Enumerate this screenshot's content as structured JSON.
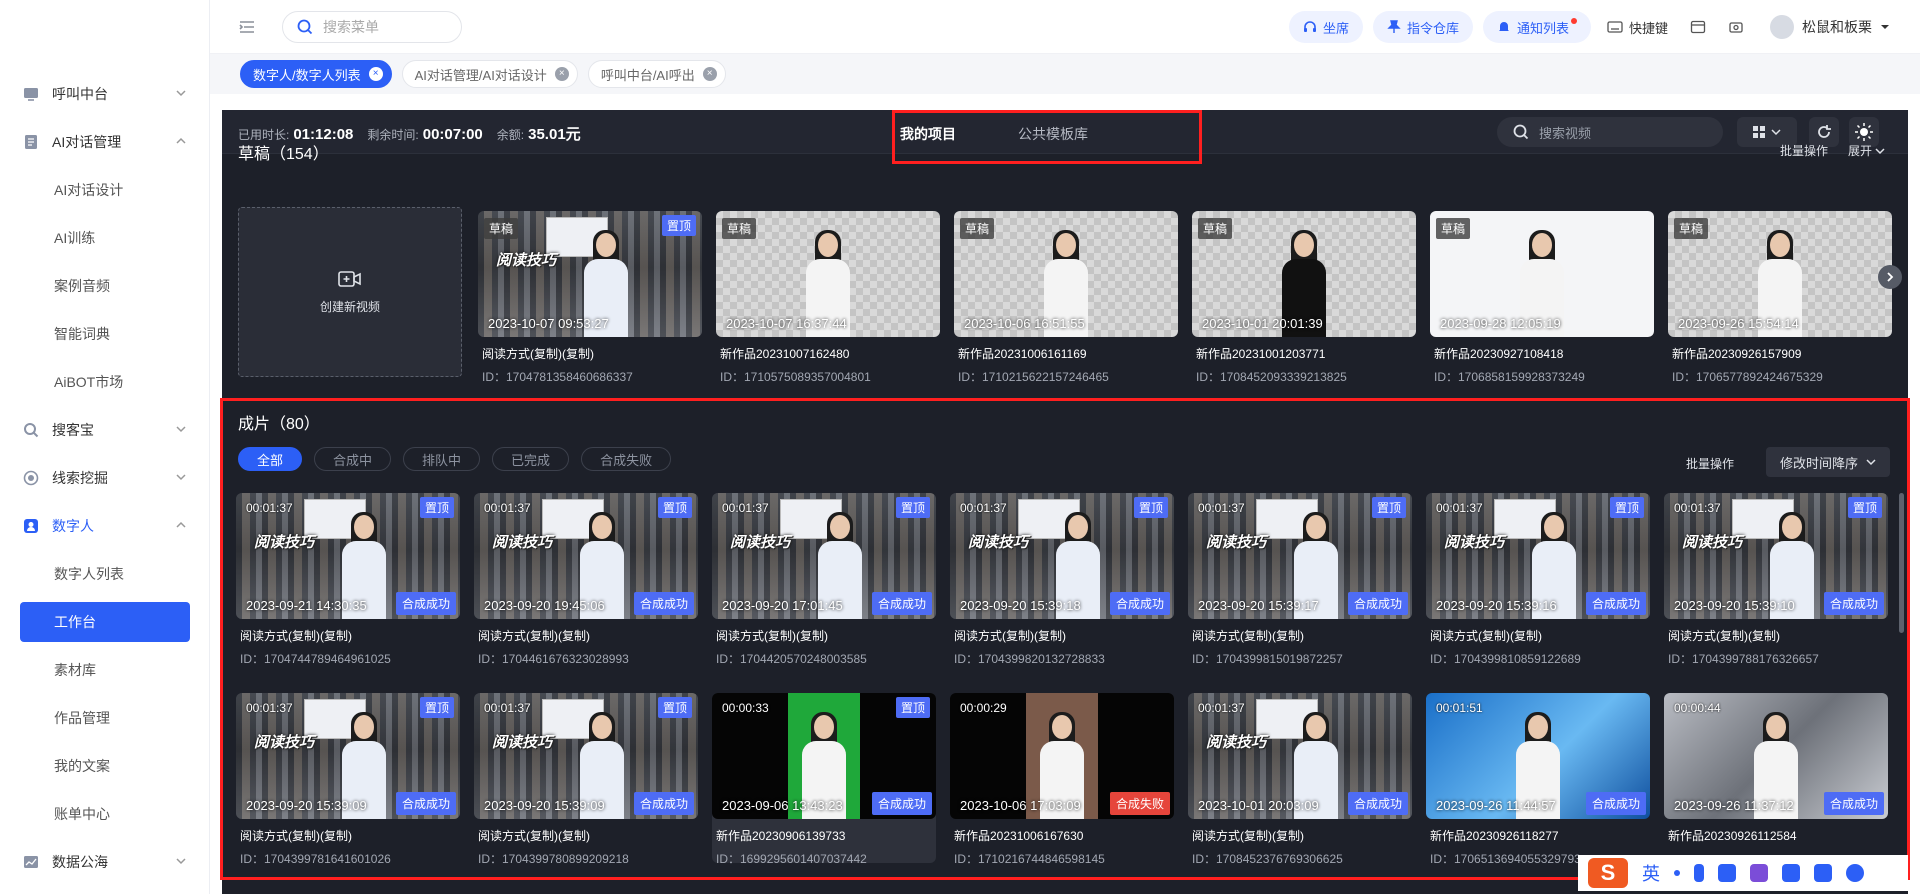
{
  "topbar": {
    "search_placeholder": "搜索菜单",
    "seat": "坐席",
    "warehouse": "指令仓库",
    "notify": "通知列表",
    "shortcut": "快捷键",
    "user": "松鼠和板栗"
  },
  "sidebar": {
    "items": [
      {
        "label": "呼叫中台",
        "icon": "phone-icon",
        "level": "group"
      },
      {
        "label": "AI对话管理",
        "icon": "document-icon",
        "level": "group-open"
      },
      {
        "label": "AI对话设计",
        "level": "sub"
      },
      {
        "label": "AI训练",
        "level": "sub"
      },
      {
        "label": "案例音频",
        "level": "sub"
      },
      {
        "label": "智能词典",
        "level": "sub"
      },
      {
        "label": "AiBOT市场",
        "level": "sub"
      },
      {
        "label": "搜客宝",
        "icon": "search-icon",
        "level": "group"
      },
      {
        "label": "线索挖掘",
        "icon": "target-icon",
        "level": "group"
      },
      {
        "label": "数字人",
        "icon": "user-icon",
        "level": "group-active"
      },
      {
        "label": "数字人列表",
        "level": "sub"
      },
      {
        "label": "工作台",
        "level": "selected"
      },
      {
        "label": "素材库",
        "level": "sub"
      },
      {
        "label": "作品管理",
        "level": "sub"
      },
      {
        "label": "我的文案",
        "level": "sub"
      },
      {
        "label": "账单中心",
        "level": "sub"
      },
      {
        "label": "数据公海",
        "icon": "chart-icon",
        "level": "group"
      }
    ]
  },
  "page_tabs": [
    {
      "label": "数字人/数字人列表",
      "active": true
    },
    {
      "label": "AI对话管理/AI对话设计",
      "active": false
    },
    {
      "label": "呼叫中台/AI呼出",
      "active": false
    }
  ],
  "panel": {
    "used_label": "已用时长:",
    "used_value": "01:12:08",
    "remain_label": "剩余时间:",
    "remain_value": "00:07:00",
    "balance_label": "余额:",
    "balance_value": "35.01元",
    "tab_mine": "我的项目",
    "tab_public": "公共模板库",
    "search_placeholder": "搜索视频"
  },
  "drafts": {
    "title": "草稿（154）",
    "batch": "批量操作",
    "expand": "展开",
    "create_label": "创建新视频",
    "items": [
      {
        "badge": "草稿",
        "top": "置顶",
        "time": "2023-10-07 09:53:27",
        "title": "阅读方式(复制)(复制)",
        "id": "ID：1704781358460686337",
        "style": "lib"
      },
      {
        "badge": "草稿",
        "top": "",
        "time": "2023-10-07 16:37:44",
        "title": "新作品20231007162480",
        "id": "ID：1710575089357004801",
        "style": "checker"
      },
      {
        "badge": "草稿",
        "top": "",
        "time": "2023-10-06 16:51:55",
        "title": "新作品20231006161169",
        "id": "ID：1710215622157246465",
        "style": "checker"
      },
      {
        "badge": "草稿",
        "top": "",
        "time": "2023-10-01 20:01:39",
        "title": "新作品20231001203771",
        "id": "ID：1708452093339213825",
        "style": "checker"
      },
      {
        "badge": "草稿",
        "top": "",
        "time": "2023-09-28 12:05:19",
        "title": "新作品20230927108418",
        "id": "ID：1706858159928373249",
        "style": "white"
      },
      {
        "badge": "草稿",
        "top": "",
        "time": "2023-09-26 15:54:14",
        "title": "新作品20230926157909",
        "id": "ID：1706577892424675329",
        "style": "checker"
      }
    ]
  },
  "films": {
    "title": "成片（80）",
    "batch": "批量操作",
    "sort": "修改时间降序",
    "filters": [
      "全部",
      "合成中",
      "排队中",
      "已完成",
      "合成失败"
    ],
    "items": [
      {
        "dur": "00:01:37",
        "top": "置顶",
        "time": "2023-09-21 14:30:35",
        "status": "合成成功",
        "title": "阅读方式(复制)(复制)",
        "id": "ID：1704744789464961025",
        "style": "lib"
      },
      {
        "dur": "00:01:37",
        "top": "置顶",
        "time": "2023-09-20 19:45:06",
        "status": "合成成功",
        "title": "阅读方式(复制)(复制)",
        "id": "ID：1704461676323028993",
        "style": "lib"
      },
      {
        "dur": "00:01:37",
        "top": "置顶",
        "time": "2023-09-20 17:01:45",
        "status": "合成成功",
        "title": "阅读方式(复制)(复制)",
        "id": "ID：1704420570248003585",
        "style": "lib"
      },
      {
        "dur": "00:01:37",
        "top": "置顶",
        "time": "2023-09-20 15:39:18",
        "status": "合成成功",
        "title": "阅读方式(复制)(复制)",
        "id": "ID：1704399820132728833",
        "style": "lib"
      },
      {
        "dur": "00:01:37",
        "top": "置顶",
        "time": "2023-09-20 15:39:17",
        "status": "合成成功",
        "title": "阅读方式(复制)(复制)",
        "id": "ID：1704399815019872257",
        "style": "lib"
      },
      {
        "dur": "00:01:37",
        "top": "置顶",
        "time": "2023-09-20 15:39:16",
        "status": "合成成功",
        "title": "阅读方式(复制)(复制)",
        "id": "ID：1704399810859122689",
        "style": "lib"
      },
      {
        "dur": "00:01:37",
        "top": "置顶",
        "time": "2023-09-20 15:39:10",
        "status": "合成成功",
        "title": "阅读方式(复制)(复制)",
        "id": "ID：1704399788176326657",
        "style": "lib"
      },
      {
        "dur": "00:01:37",
        "top": "置顶",
        "time": "2023-09-20 15:39:09",
        "status": "合成成功",
        "title": "阅读方式(复制)(复制)",
        "id": "ID：1704399781641601026",
        "style": "lib"
      },
      {
        "dur": "00:01:37",
        "top": "置顶",
        "time": "2023-09-20 15:39:09",
        "status": "合成成功",
        "title": "阅读方式(复制)(复制)",
        "id": "ID：1704399780899209218",
        "style": "lib"
      },
      {
        "dur": "00:00:33",
        "top": "置顶",
        "time": "2023-09-06 13:43:23",
        "status": "合成成功",
        "title": "新作品20230906139733",
        "id": "ID：1699295601407037442",
        "style": "green"
      },
      {
        "dur": "00:00:29",
        "top": "",
        "time": "2023-10-06 17:03:09",
        "status": "合成失败",
        "title": "新作品20231006167630",
        "id": "ID：1710216744846598145",
        "style": "blk"
      },
      {
        "dur": "00:01:37",
        "top": "",
        "time": "2023-10-01 20:03:09",
        "status": "合成成功",
        "title": "阅读方式(复制)(复制)",
        "id": "ID：1708452376769306625",
        "style": "lib"
      },
      {
        "dur": "00:01:51",
        "top": "",
        "time": "2023-09-26 11:44:57",
        "status": "合成成功",
        "title": "新作品20230926118277",
        "id": "ID：1706513694055329793",
        "style": "tech"
      },
      {
        "dur": "00:00:44",
        "top": "",
        "time": "2023-09-26 11:37:12",
        "status": "合成成功",
        "title": "新作品20230926112584",
        "id": "",
        "style": "silver"
      }
    ]
  },
  "overlay_text": "阅读技巧",
  "ime": {
    "lang": "英"
  }
}
